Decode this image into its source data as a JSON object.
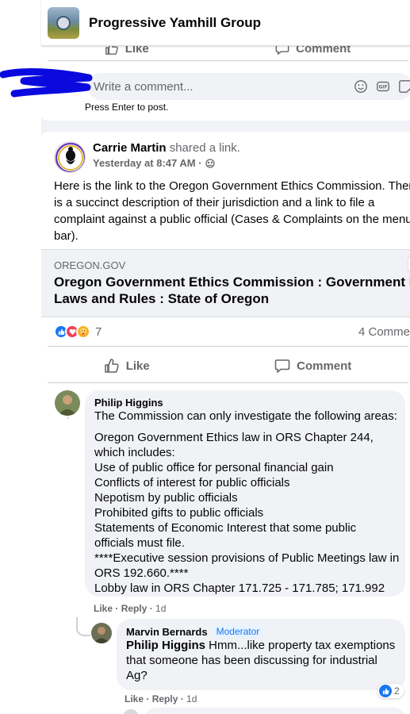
{
  "group": {
    "name": "Progressive Yamhill Group"
  },
  "prev_post": {
    "like_label": "Like",
    "comment_label": "Comment",
    "comment_placeholder": "Write a comment...",
    "press_enter": "Press Enter to post."
  },
  "post": {
    "author": "Carrie Martin",
    "action": "shared a link.",
    "timestamp": "Yesterday at 8:47 AM ·",
    "text_lines": [
      "Here is the link to the Oregon Government Ethics Commission. There",
      "is a succinct description of their jurisdiction and a link to file a",
      "complaint against a public official (Cases & Complaints on the menu",
      "bar)."
    ],
    "link": {
      "domain": "OREGON.GOV",
      "title_lines": [
        "Oregon Government Ethics Commission : Government Ethi",
        "Laws and Rules : State of Oregon"
      ]
    },
    "reaction_count": "7",
    "comment_count": "4 Comme",
    "like_label": "Like",
    "comment_label": "Comment"
  },
  "comments": [
    {
      "author": "Philip Higgins",
      "lines": [
        "The Commission can only investigate the following areas:",
        "",
        "Oregon Government Ethics law in ORS Chapter 244,",
        "which includes:",
        "Use of public office for personal financial gain",
        "Conflicts of interest for public officials",
        "Nepotism by public officials",
        "Prohibited gifts to public officials",
        "Statements of Economic Interest that some public",
        "officials must file.",
        "****Executive session provisions of Public Meetings law in",
        "ORS 192.660.****",
        "Lobby law in ORS Chapter 171.725 - 171.785; 171.992"
      ],
      "like": "Like",
      "reply": "Reply",
      "time": "1d"
    },
    {
      "author": "Marvin Bernards",
      "badge": "Moderator",
      "mention": "Philip Higgins",
      "lines": [
        "Hmm...like property tax exemptions",
        "that someone has been discussing for industrial",
        "Ag?"
      ],
      "like": "Like",
      "reply": "Reply",
      "time": "1d",
      "like_count": "2"
    }
  ],
  "colors": {
    "accent": "#1877f2",
    "muted": "#65676b",
    "bubble": "#f0f2f5",
    "scribble": "#0a0adf"
  }
}
